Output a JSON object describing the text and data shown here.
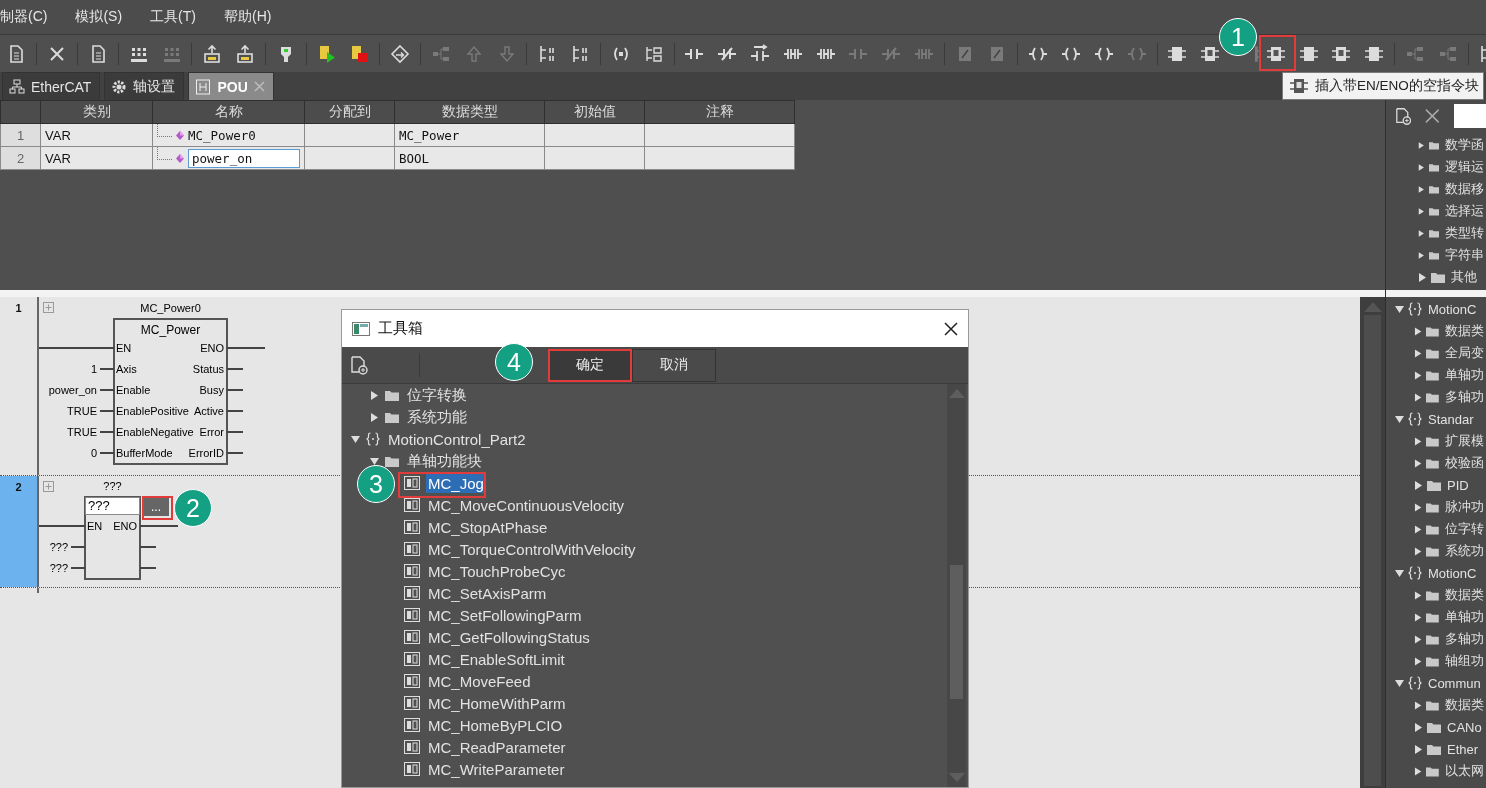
{
  "menu": [
    {
      "label": "制器(C)"
    },
    {
      "label": "模拟(S)"
    },
    {
      "label": "工具(T)"
    },
    {
      "label": "帮助(H)"
    }
  ],
  "tabs": [
    {
      "label": "EtherCAT",
      "kind": "network",
      "selected": false,
      "closable": false
    },
    {
      "label": "轴设置",
      "kind": "gear",
      "selected": false,
      "closable": false
    },
    {
      "label": "POU",
      "kind": "pou",
      "selected": true,
      "closable": true
    }
  ],
  "tooltip": {
    "text": "插入带EN/ENO的空指令块"
  },
  "variables": {
    "columns": [
      "类别",
      "名称",
      "分配到",
      "数据类型",
      "初始值",
      "注释"
    ],
    "rows": [
      {
        "number": "1",
        "category": "VAR",
        "name": "MC_Power0",
        "data_type": "MC_Power",
        "editing": false
      },
      {
        "number": "2",
        "category": "VAR",
        "name": "power_on",
        "data_type": "BOOL",
        "editing": true
      }
    ]
  },
  "library": {
    "upper": [
      {
        "kind": "offscreen",
        "children": [
          {
            "kind": "folder",
            "label": "数学函",
            "expanded": false
          },
          {
            "kind": "folder",
            "label": "逻辑运",
            "expanded": false
          },
          {
            "kind": "folder",
            "label": "数据移",
            "expanded": false
          },
          {
            "kind": "folder",
            "label": "选择运",
            "expanded": false
          },
          {
            "kind": "folder",
            "label": "类型转",
            "expanded": false
          },
          {
            "kind": "folder",
            "label": "字符串",
            "expanded": false
          },
          {
            "kind": "folder",
            "label": "其他",
            "expanded": false
          }
        ]
      }
    ],
    "lower": [
      {
        "kind": "namespace",
        "label": "MotionC",
        "expanded": true,
        "children": [
          {
            "kind": "folder",
            "label": "数据类",
            "expanded": false
          },
          {
            "kind": "folder",
            "label": "全局变",
            "expanded": false
          },
          {
            "kind": "folder",
            "label": "单轴功",
            "expanded": false
          },
          {
            "kind": "folder",
            "label": "多轴功",
            "expanded": false
          }
        ]
      },
      {
        "kind": "namespace",
        "label": "Standar",
        "expanded": true,
        "children": [
          {
            "kind": "folder",
            "label": "扩展模",
            "expanded": false
          },
          {
            "kind": "folder",
            "label": "校验函",
            "expanded": false
          },
          {
            "kind": "folder",
            "label": "PID",
            "expanded": false
          },
          {
            "kind": "folder",
            "label": "脉冲功",
            "expanded": false
          },
          {
            "kind": "folder",
            "label": "位字转",
            "expanded": false
          },
          {
            "kind": "folder",
            "label": "系统功",
            "expanded": false
          }
        ]
      },
      {
        "kind": "namespace",
        "label": "MotionC",
        "expanded": true,
        "children": [
          {
            "kind": "folder",
            "label": "数据类",
            "expanded": false
          },
          {
            "kind": "folder",
            "label": "单轴功",
            "expanded": false
          },
          {
            "kind": "folder",
            "label": "多轴功",
            "expanded": false
          },
          {
            "kind": "folder",
            "label": "轴组功",
            "expanded": false
          }
        ]
      },
      {
        "kind": "namespace",
        "label": "Commun",
        "expanded": true,
        "children": [
          {
            "kind": "folder",
            "label": "数据类",
            "expanded": false
          },
          {
            "kind": "folder",
            "label": "CANo",
            "expanded": false
          },
          {
            "kind": "folder",
            "label": "Ether",
            "expanded": false
          },
          {
            "kind": "folder",
            "label": "以太网",
            "expanded": false
          }
        ]
      }
    ]
  },
  "ladder": {
    "rungs": [
      {
        "number": "1",
        "selected": false,
        "instance": "MC_Power0",
        "block": {
          "title": "MC_Power",
          "inputs": [
            {
              "name": "EN"
            },
            {
              "name": "Axis",
              "value": "1"
            },
            {
              "name": "Enable",
              "value": "power_on"
            },
            {
              "name": "EnablePositive",
              "value": "TRUE"
            },
            {
              "name": "EnableNegative",
              "value": "TRUE"
            },
            {
              "name": "BufferMode",
              "value": "0"
            }
          ],
          "outputs": [
            {
              "kind": "named",
              "name": "ENO"
            },
            {
              "kind": "named",
              "name": "Status"
            },
            {
              "kind": "named",
              "name": "Busy"
            },
            {
              "kind": "named",
              "name": "Active"
            },
            {
              "kind": "named",
              "name": "Error"
            },
            {
              "kind": "named",
              "name": "ErrorID"
            }
          ]
        }
      },
      {
        "number": "2",
        "selected": true,
        "instance": "???",
        "block": {
          "type_field": "???",
          "browse_button": "...",
          "inputs": [
            {
              "name": "EN"
            },
            {
              "value": "???"
            },
            {
              "value": "???"
            }
          ],
          "outputs": [
            {
              "kind": "named",
              "name": "ENO"
            },
            {
              "kind": "bare"
            },
            {
              "kind": "bare"
            }
          ]
        }
      }
    ]
  },
  "dialog": {
    "title": "工具箱",
    "buttons": [
      {
        "label": "确定",
        "kind": "ok"
      },
      {
        "label": "取消",
        "kind": "cancel"
      }
    ],
    "tree": [
      {
        "kind": "offscreen",
        "children": [
          {
            "kind": "folder",
            "label": "位字转换",
            "expanded": false
          },
          {
            "kind": "folder",
            "label": "系统功能",
            "expanded": false
          }
        ]
      },
      {
        "kind": "namespace",
        "label": "MotionControl_Part2",
        "expanded": true,
        "children": [
          {
            "kind": "folder",
            "label": "单轴功能块",
            "expanded": true,
            "children": [
              {
                "kind": "fb",
                "label": "MC_Jog",
                "selected": true
              },
              {
                "kind": "fb",
                "label": "MC_MoveContinuousVelocity",
                "selected": false
              },
              {
                "kind": "fb",
                "label": "MC_StopAtPhase",
                "selected": false
              },
              {
                "kind": "fb",
                "label": "MC_TorqueControlWithVelocity",
                "selected": false
              },
              {
                "kind": "fb",
                "label": "MC_TouchProbeCyc",
                "selected": false
              },
              {
                "kind": "fb",
                "label": "MC_SetAxisParm",
                "selected": false
              },
              {
                "kind": "fb",
                "label": "MC_SetFollowingParm",
                "selected": false
              },
              {
                "kind": "fb",
                "label": "MC_GetFollowingStatus",
                "selected": false
              },
              {
                "kind": "fb",
                "label": "MC_EnableSoftLimit",
                "selected": false
              },
              {
                "kind": "fb",
                "label": "MC_MoveFeed",
                "selected": false
              },
              {
                "kind": "fb",
                "label": "MC_HomeWithParm",
                "selected": false
              },
              {
                "kind": "fb",
                "label": "MC_HomeByPLCIO",
                "selected": false
              },
              {
                "kind": "fb",
                "label": "MC_ReadParameter",
                "selected": false
              },
              {
                "kind": "fb",
                "label": "MC_WriteParameter",
                "selected": false
              }
            ]
          }
        ]
      }
    ]
  },
  "annotations": [
    {
      "number": "1"
    },
    {
      "number": "2"
    },
    {
      "number": "3"
    },
    {
      "number": "4"
    }
  ]
}
